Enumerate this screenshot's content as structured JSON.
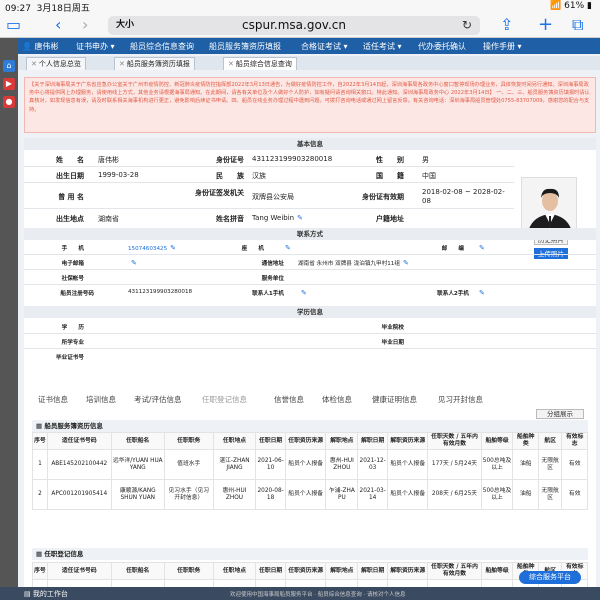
{
  "status": {
    "time": "09:27",
    "date": "3月18日周五",
    "battery": "61%"
  },
  "browser": {
    "aa": "大小",
    "url": "cspur.msa.gov.cn"
  },
  "topnav": {
    "user": "唐伟彬",
    "items": [
      "证书申办 ▾",
      "船员综合信息查询",
      "船员服务簿资历填报",
      "合格证考试 ▾",
      "适任考试 ▾",
      "代办委托确认",
      "操作手册 ▾"
    ]
  },
  "tabs": [
    "个人信息总览",
    "船员服务簿资历填报",
    "船员综合信息查询"
  ],
  "notice": "【关于深圳海事局关于广东省应急办公室关于广州市疫情防控、新冠肺炎疫情防控指挥部2022年3月13日通告，为做好疫情防控工作，自2022年3月14日起，深圳海事局各政务中心窗口暂停现场办理业务，具体恢复时间另行通知。深圳海事局政务中心将提供网上办理服务，请使用线上方式，其他业务请根据海事局通知。在此期间，请各有关单位及个人做好个人防护，如有疑问请咨询相关窗口。特此通知。深圳海事局政务中心 2022年3月14日】 一、二、三、船员服务簿资历填报时请认真核对，如发现信息有误，请及时联系相关海事机构进行更正，避免影响后续证书申请。四、船员在线业务办理过程中遇到问题，可拨打咨询电话或通过网上留言反馈。有关咨询电话：深圳海事局船员管理处0755-83707009，感谢您的配合与支持。",
  "basic": {
    "title": "基本信息",
    "name_lbl": "姓　　名",
    "name": "唐伟彬",
    "id_lbl": "身份证号",
    "id": "431123199903280018",
    "sex_lbl": "性　　别",
    "sex": "男",
    "birth_lbl": "出生日期",
    "birth": "1999-03-28",
    "nation_lbl": "民　　族",
    "nation": "汉族",
    "country_lbl": "国　　籍",
    "country": "中国",
    "former_lbl": "曾 用 名",
    "former": "",
    "idissuer_lbl": "身份证签发机关",
    "idissuer": "双牌县公安局",
    "idvalid_lbl": "身份证有效期",
    "idvalid": "2018-02-08 ~ 2028-02-08",
    "birthplace_lbl": "出生地点",
    "birthplace": "湖南省",
    "pinyin_lbl": "姓名拼音",
    "pinyin": "Tang Weibin",
    "hukou_lbl": "户籍地址",
    "hukou": "",
    "photo_btn": "历史照片",
    "upload_btn": "上传照片"
  },
  "contact": {
    "title": "联系方式",
    "phone_lbl": "手　　机",
    "phone": "15074603425",
    "tel_lbl": "座　　机",
    "tel": "",
    "post_lbl": "邮　　编",
    "post": "",
    "email_lbl": "电子邮箱",
    "email": "",
    "addr_lbl": "通信地址",
    "addr": "湖南省 永州市 双牌县 泷泊镇九甲村11组",
    "social_lbl": "社保帐号",
    "social": "",
    "unit_lbl": "服务单位",
    "unit": "",
    "reg_lbl": "船员注册号码",
    "reg": "431123199903280018",
    "c1_lbl": "联系人1手机",
    "c1": "",
    "c2_lbl": "联系人2手机",
    "c2": ""
  },
  "edu": {
    "title": "学历信息",
    "degree_lbl": "学　　历",
    "school_lbl": "毕业院校",
    "major_lbl": "所学专业",
    "date_lbl": "毕业日期",
    "cert_lbl": "毕业证书号"
  },
  "subtabs": [
    "证书信息",
    "培训信息",
    "考试/评估信息",
    "任职登记信息",
    "信誉信息",
    "体检信息",
    "健康证明信息",
    "见习开封信息"
  ],
  "grid1": {
    "title": "船员服务簿资历信息",
    "btn": "分组展示",
    "headers": [
      "序号",
      "适任证书号码",
      "任职船名",
      "任职职务",
      "任职地点",
      "任职日期",
      "任职资历来源",
      "解职地点",
      "解职日期",
      "解职资历来源",
      "任职天数 / 五年内有效月数",
      "船舶等级",
      "船舶种类",
      "航区",
      "有效标志"
    ],
    "rows": [
      [
        "1",
        "ABE145202100442",
        "远华洋/YUAN HUA YANG",
        "值班水手",
        "湛江-ZHAN JIANG",
        "2021-06-10",
        "船员个人报备",
        "惠州-HUI ZHOU",
        "2021-12-03",
        "船员个人报备",
        "177天 / 5月24天",
        "500总吨及以上",
        "油船",
        "无限航区",
        "有效"
      ],
      [
        "2",
        "APC001201905414",
        "康顺源/KANG SHUN YUAN",
        "见习水手（见习开封信息）",
        "惠州-HUI ZHOU",
        "2020-08-18",
        "船员个人报备",
        "乍浦-ZHA PU",
        "2021-03-14",
        "船员个人报备",
        "208天 / 6月25天",
        "500总吨及以上",
        "油船",
        "无限航区",
        "有效"
      ]
    ]
  },
  "grid2": {
    "title": "任职登记信息",
    "headers": [
      "序号",
      "适任证书号码",
      "任职船名",
      "任职职务",
      "任职地点",
      "任职日期",
      "任职资历来源",
      "解职地点",
      "解职日期",
      "解职资历来源",
      "任职天数 / 五年内有效月数",
      "船舶等级",
      "船舶种类",
      "航区",
      "有效标志"
    ],
    "partial": [
      "1",
      "",
      "远华",
      "",
      "湛江",
      "",
      "中国籍船舶",
      "惠州",
      "",
      "中国籍船舶",
      "",
      "500总吨",
      "",
      "",
      ""
    ]
  },
  "bottom": {
    "work": "我的工作台",
    "scroll": "欢迎使用中国海事局船员服务平台 · 船员综合信息查询 · 请核对个人信息"
  },
  "float_btn": "综合服务平台"
}
